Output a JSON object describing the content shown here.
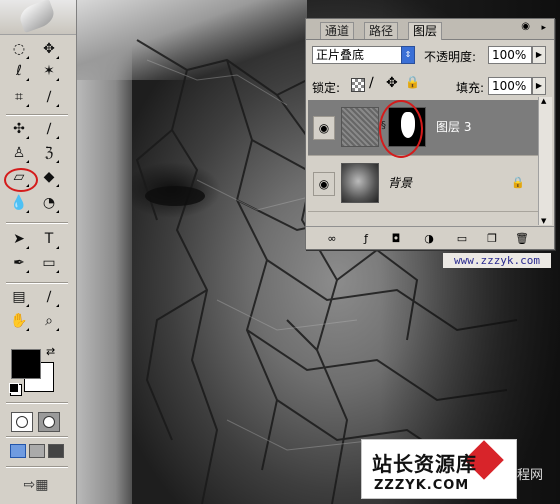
{
  "toolbox": {
    "tools": [
      {
        "name": "marquee-icon",
        "glyph": "◌"
      },
      {
        "name": "move-icon",
        "glyph": "✥"
      },
      {
        "name": "lasso-icon",
        "glyph": "ℓ"
      },
      {
        "name": "magic-wand-icon",
        "glyph": "✶"
      },
      {
        "name": "crop-icon",
        "glyph": "⌗"
      },
      {
        "name": "slice-icon",
        "glyph": "∕"
      },
      {
        "name": "healing-brush-icon",
        "glyph": "✣"
      },
      {
        "name": "brush-icon",
        "glyph": "∕"
      },
      {
        "name": "clone-stamp-icon",
        "glyph": "♙"
      },
      {
        "name": "history-brush-icon",
        "glyph": "ℨ"
      },
      {
        "name": "eraser-icon",
        "glyph": "▱"
      },
      {
        "name": "paint-bucket-icon",
        "glyph": "◆"
      },
      {
        "name": "blur-icon",
        "glyph": "💧"
      },
      {
        "name": "dodge-icon",
        "glyph": "◔"
      },
      {
        "name": "path-select-icon",
        "glyph": "➤"
      },
      {
        "name": "type-icon",
        "glyph": "T"
      },
      {
        "name": "pen-icon",
        "glyph": "✒"
      },
      {
        "name": "rectangle-shape-icon",
        "glyph": "▭"
      },
      {
        "name": "notes-icon",
        "glyph": "▤"
      },
      {
        "name": "eyedropper-icon",
        "glyph": "∕"
      },
      {
        "name": "hand-icon",
        "glyph": "✋"
      },
      {
        "name": "zoom-icon",
        "glyph": "⌕"
      }
    ],
    "foreground_color": "#000000",
    "background_color": "#ffffff"
  },
  "layers_panel": {
    "tabs": [
      {
        "label": "通道"
      },
      {
        "label": "路径"
      },
      {
        "label": "图层"
      }
    ],
    "blend_mode": "正片叠底",
    "opacity_label": "不透明度:",
    "opacity_value": "100%",
    "lock_label": "锁定:",
    "fill_label": "填充:",
    "fill_value": "100%",
    "layers": [
      {
        "name": "图层 3",
        "selected": true
      },
      {
        "name": "背景",
        "selected": false
      }
    ]
  },
  "watermarks": {
    "url": "www.zzzyk.com",
    "site_title": "站长资源库",
    "site_domain": "ZZZYK.COM",
    "side_text": "程网"
  }
}
